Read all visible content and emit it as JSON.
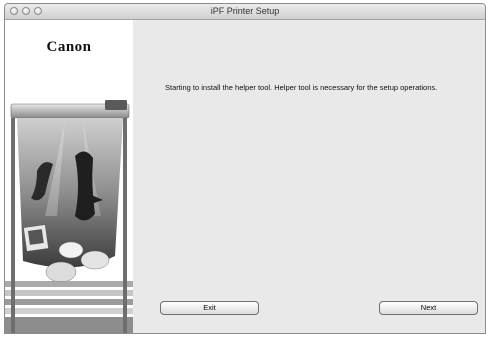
{
  "window": {
    "title": "iPF Printer Setup"
  },
  "sidebar": {
    "logo_text": "Canon"
  },
  "content": {
    "message": "Starting to install the helper tool. Helper tool is necessary for the setup operations."
  },
  "buttons": {
    "exit_label": "Exit",
    "next_label": "Next"
  },
  "icons": {
    "close": "close-button-icon",
    "minimize": "minimize-button-icon",
    "zoom": "zoom-button-icon",
    "printer_illustration": "printer-illustration"
  }
}
